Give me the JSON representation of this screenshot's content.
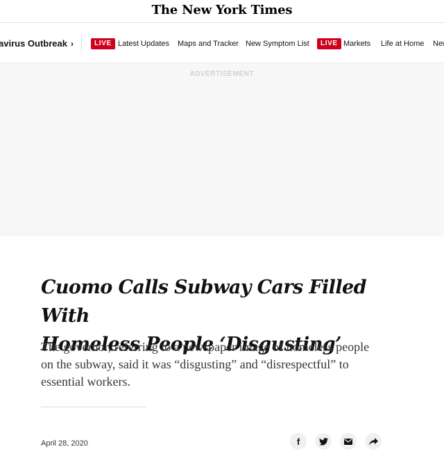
{
  "masthead": {
    "logo_text": "The New York Times"
  },
  "nav": {
    "section_label": "avirus Outbreak",
    "section_chevron": "›",
    "live_badge": "LIVE",
    "items": [
      "Latest Updates",
      "Maps and Tracker",
      "New Symptom List",
      "Markets",
      "Life at Home",
      "New"
    ],
    "live_color": "#d0021b"
  },
  "ad": {
    "label": "ADVERTISEMENT"
  },
  "article": {
    "headline_line1": "Cuomo Calls Subway Cars Filled With",
    "headline_line2": "Homeless People ‘Disgusting’",
    "summary_line1": "The governor, referring to a newspaper image of homeless people",
    "summary_line2": "on the subway, said it was “disgusting” and “disrespectful” to",
    "summary_line3": "essential workers.",
    "date": "April 28, 2020"
  },
  "share": {
    "icons": [
      "facebook-icon",
      "twitter-icon",
      "email-icon",
      "share-arrow-icon"
    ],
    "facebook_glyph": "f"
  }
}
